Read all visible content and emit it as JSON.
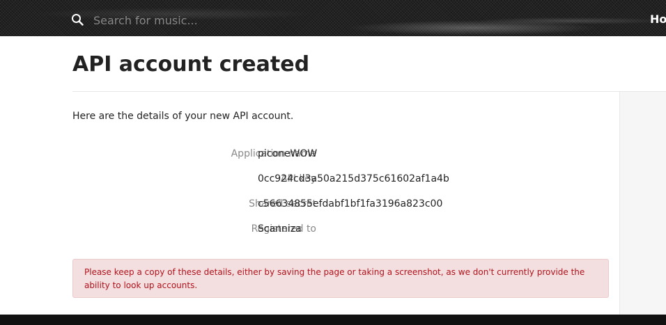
{
  "header": {
    "search": {
      "placeholder": "Search for music..."
    },
    "nav": {
      "home_label": "Ho"
    }
  },
  "page": {
    "title": "API account created",
    "intro": "Here are the details of your new API account."
  },
  "details": [
    {
      "label": "Application name",
      "value": "piconeWOW"
    },
    {
      "label": "API key",
      "value": "0cc924cd3a50a215d375c61602af1a4b"
    },
    {
      "label": "Shared secret",
      "value": "c56634855efdabf1bf1fa3196a823c00"
    },
    {
      "label": "Registered to",
      "value": "Scanniza"
    }
  ],
  "alert": {
    "text": "Please keep a copy of these details, either by saving the page or taking a screenshot, as we don't currently provide the ability to look up accounts."
  },
  "colors": {
    "header_bg": "#1a1a1a",
    "alert_bg": "#f4dfe0",
    "alert_text": "#b0121b",
    "label_text": "#888888"
  },
  "icons": {
    "search": "search-icon"
  }
}
